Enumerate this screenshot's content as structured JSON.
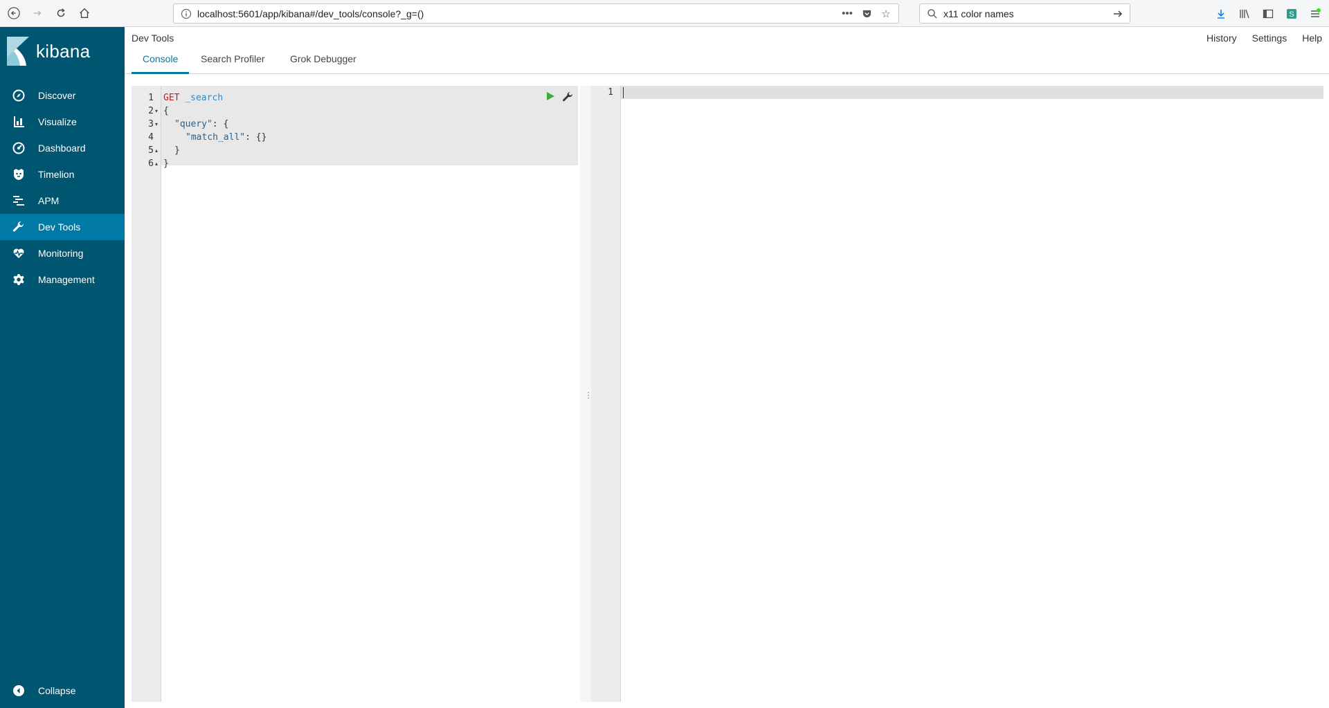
{
  "browser": {
    "url": "localhost:5601/app/kibana#/dev_tools/console?_g=()",
    "search_text": "x11 color names"
  },
  "sidebar": {
    "brand": "kibana",
    "items": [
      {
        "label": "Discover",
        "icon": "compass-icon"
      },
      {
        "label": "Visualize",
        "icon": "bar-chart-icon"
      },
      {
        "label": "Dashboard",
        "icon": "dashboard-icon"
      },
      {
        "label": "Timelion",
        "icon": "timelion-icon"
      },
      {
        "label": "APM",
        "icon": "apm-icon"
      },
      {
        "label": "Dev Tools",
        "icon": "wrench-icon",
        "active": true
      },
      {
        "label": "Monitoring",
        "icon": "heartbeat-icon"
      },
      {
        "label": "Management",
        "icon": "gear-icon"
      }
    ],
    "collapse_label": "Collapse"
  },
  "app": {
    "title": "Dev Tools",
    "links": [
      "History",
      "Settings",
      "Help"
    ],
    "tabs": [
      "Console",
      "Search Profiler",
      "Grok Debugger"
    ],
    "active_tab": "Console"
  },
  "editor": {
    "line_numbers": [
      "1",
      "2",
      "3",
      "4",
      "5",
      "6"
    ],
    "lines": [
      {
        "method": "GET",
        "path": "_search"
      },
      {
        "text": "{"
      },
      {
        "key": "\"query\"",
        "rest": ": {"
      },
      {
        "key": "\"match_all\"",
        "rest": ": {}"
      },
      {
        "text": "}"
      },
      {
        "text": "}"
      }
    ]
  },
  "output": {
    "line_numbers": [
      "1"
    ]
  },
  "colors": {
    "sidebar_bg": "#005571",
    "sidebar_active": "#0079a5",
    "accent": "#0079a5"
  }
}
